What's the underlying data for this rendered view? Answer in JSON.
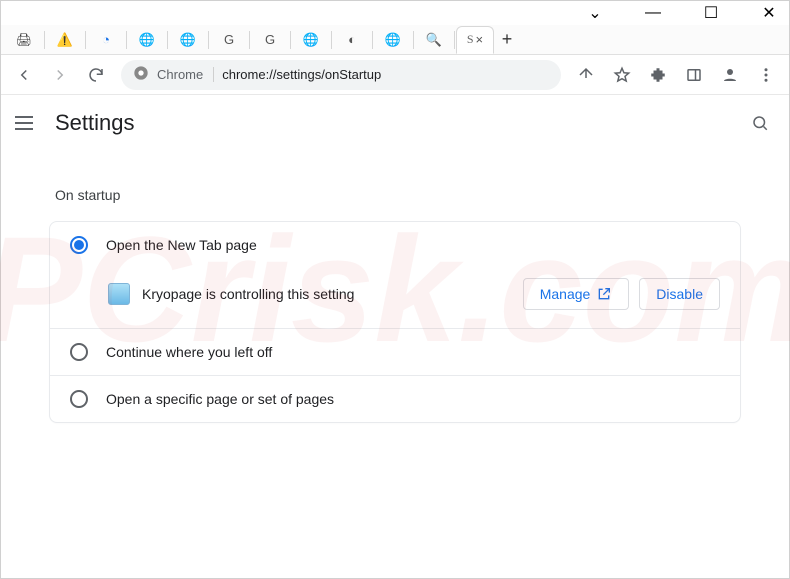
{
  "window": {
    "dropdown_glyph": "⌄",
    "minimize_glyph": "—",
    "maximize_glyph": "☐",
    "close_glyph": "✕"
  },
  "tabs": {
    "new_tab_glyph": "+",
    "active_close_glyph": "×",
    "active_favicon": "S"
  },
  "toolbar": {
    "chip_label": "Chrome",
    "url": "chrome://settings/onStartup"
  },
  "header": {
    "title": "Settings"
  },
  "content": {
    "section_label": "On startup",
    "options": [
      {
        "label": "Open the New Tab page",
        "selected": true
      },
      {
        "label": "Continue where you left off",
        "selected": false
      },
      {
        "label": "Open a specific page or set of pages",
        "selected": false
      }
    ],
    "extension_notice": "Kryopage is controlling this setting",
    "manage_label": "Manage",
    "disable_label": "Disable"
  },
  "watermark": "PCrisk.com"
}
